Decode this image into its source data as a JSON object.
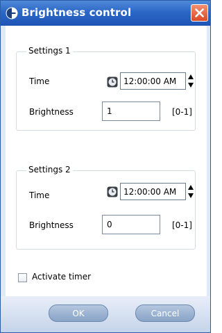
{
  "window": {
    "title": "Brightness control",
    "icons": {
      "app": "brightness-icon",
      "close": "close-icon"
    }
  },
  "settings": [
    {
      "legend": "Settings 1",
      "time_label": "Time",
      "time_value": "12:00:00 AM",
      "brightness_label": "Brightness",
      "brightness_value": "1",
      "range_label": "[0-1]"
    },
    {
      "legend": "Settings 2",
      "time_label": "Time",
      "time_value": "12:00:00 AM",
      "brightness_label": "Brightness",
      "brightness_value": "0",
      "range_label": "[0-1]"
    }
  ],
  "timer": {
    "label": "Activate timer",
    "checked": false
  },
  "buttons": {
    "ok": "OK",
    "cancel": "Cancel"
  },
  "colors": {
    "title_bar": "#2c67c6",
    "close_button": "#d94a25",
    "button": "#9db4d2"
  }
}
